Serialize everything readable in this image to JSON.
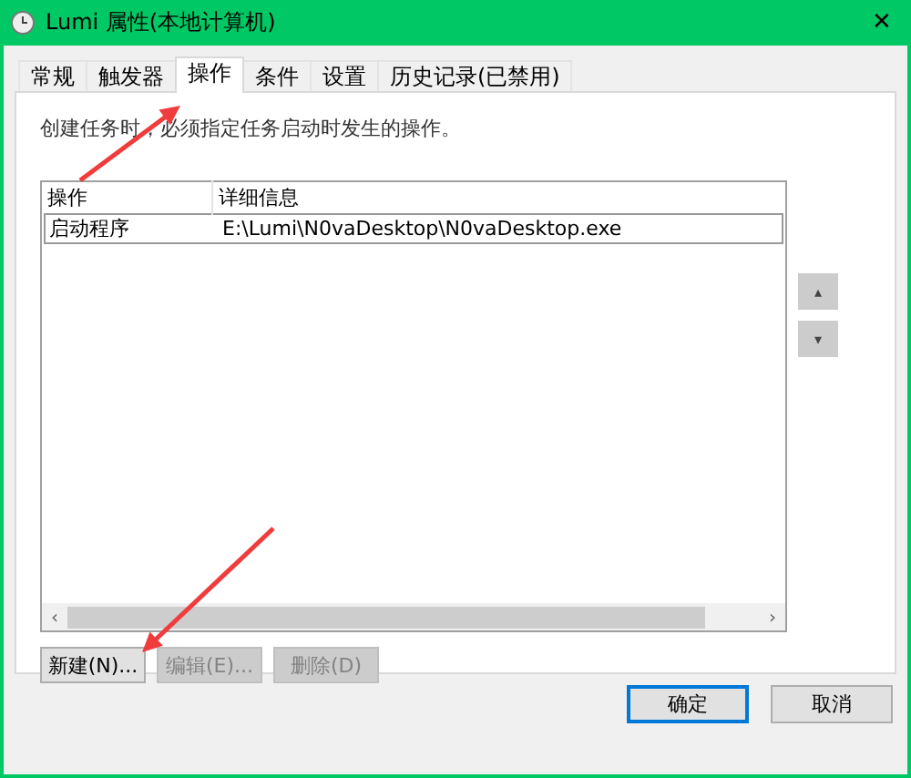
{
  "window": {
    "title": "Lumi 属性(本地计算机)",
    "close": "✕"
  },
  "tabs": [
    {
      "label": "常规",
      "selected": false
    },
    {
      "label": "触发器",
      "selected": false
    },
    {
      "label": "操作",
      "selected": true
    },
    {
      "label": "条件",
      "selected": false
    },
    {
      "label": "设置",
      "selected": false
    },
    {
      "label": "历史记录(已禁用)",
      "selected": false
    }
  ],
  "description": "创建任务时，必须指定任务启动时发生的操作。",
  "table": {
    "columns": [
      "操作",
      "详细信息"
    ],
    "rows": [
      {
        "cells": [
          "启动程序",
          "E:\\Lumi\\N0vaDesktop\\N0vaDesktop.exe"
        ],
        "selected": true
      }
    ]
  },
  "scrollbar": {
    "left": "‹",
    "right": "›"
  },
  "move_buttons": [
    {
      "label": "▴"
    },
    {
      "label": "▾"
    }
  ],
  "actions": [
    {
      "label": "新建(N)...",
      "disabled": false
    },
    {
      "label": "编辑(E)...",
      "disabled": true
    },
    {
      "label": "删除(D)",
      "disabled": true
    }
  ],
  "dialog_buttons": [
    {
      "label": "确定",
      "default": true
    },
    {
      "label": "取消",
      "default": false
    }
  ]
}
